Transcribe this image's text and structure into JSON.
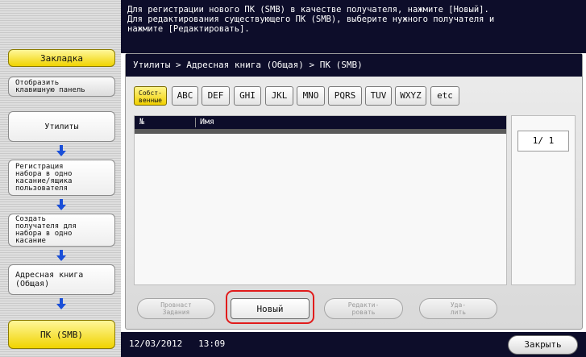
{
  "message": "Для регистрации нового ПК (SMB) в качестве получателя, нажмите [Новый].\nДля редактирования существующего ПК (SMB), выберите нужного получателя и\nнажмите [Редактировать].",
  "breadcrumb": "Утилиты > Адресная книга (Общая) > ПК (SMB)",
  "left_panel": {
    "bookmark": "Закладка",
    "show_keyboard": "Отобразить\nклавишную панель",
    "steps": [
      "Утилиты",
      "Регистрация\nнабора в одно\nкасание/ящика\nпользователя",
      "Создать\nполучателя для\nнабора в одно\nкасание",
      "Адресная книга\n(Общая)",
      "ПК (SMB)"
    ]
  },
  "tabs": [
    "Собст-\nвенные",
    "ABC",
    "DEF",
    "GHI",
    "JKL",
    "MNO",
    "PQRS",
    "TUV",
    "WXYZ",
    "etc"
  ],
  "list": {
    "columns": [
      "№",
      "Имя"
    ],
    "rows": []
  },
  "pager": "1/  1",
  "actions": {
    "check_job": "Провнаст\nЗадания",
    "new": "Новый",
    "edit": "Редакти-\nровать",
    "delete": "Уда-\nлить"
  },
  "status": {
    "date": "12/03/2012",
    "time": "13:09"
  },
  "close": "Закрыть",
  "colors": {
    "dark_bar": "#0d0d2a",
    "selected_yellow": "#f1d000",
    "arrow_blue": "#1a4fd8",
    "highlight_red": "#e11b1b"
  }
}
